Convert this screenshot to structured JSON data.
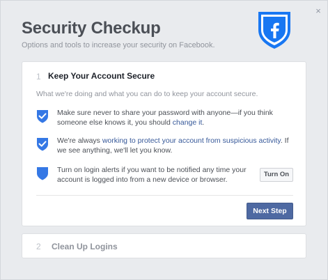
{
  "dialog": {
    "close_glyph": "×",
    "title": "Security Checkup",
    "subtitle": "Options and tools to increase your security on Facebook.",
    "hero_icon": "facebook-shield-icon",
    "brand_color": "#1877f2"
  },
  "step1": {
    "number": "1",
    "title": "Keep Your Account Secure",
    "description": "What we're doing and what you can do to keep your account secure.",
    "items": [
      {
        "icon": "check-shield-icon",
        "text_before": "Make sure never to share your password with anyone—if you think someone else knows it, you should ",
        "link": "change it",
        "text_after": "."
      },
      {
        "icon": "check-shield-icon",
        "text_before": "We're always ",
        "link": "working to protect your account from suspicious activity",
        "text_after": ". If we see anything, we'll let you know."
      },
      {
        "icon": "shield-icon",
        "text": "Turn on login alerts if you want to be notified any time your account is logged into from a new device or browser.",
        "button": "Turn On"
      }
    ],
    "next_button": "Next Step"
  },
  "step2": {
    "number": "2",
    "title": "Clean Up Logins"
  }
}
